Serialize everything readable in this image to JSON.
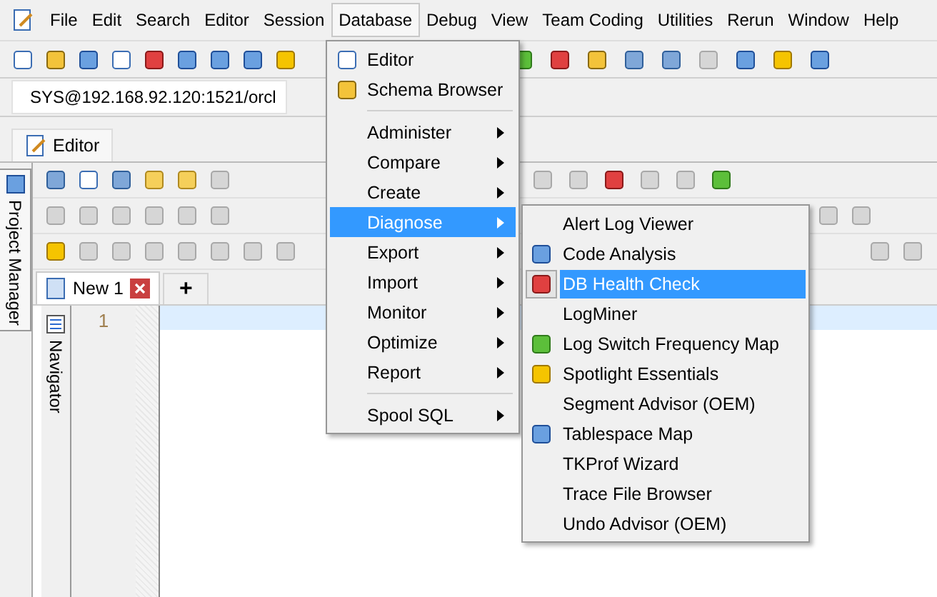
{
  "menu_bar": [
    {
      "label": "File",
      "selected": false
    },
    {
      "label": "Edit",
      "selected": false
    },
    {
      "label": "Search",
      "selected": false
    },
    {
      "label": "Editor",
      "selected": false
    },
    {
      "label": "Session",
      "selected": false
    },
    {
      "label": "Database",
      "selected": true
    },
    {
      "label": "Debug",
      "selected": false
    },
    {
      "label": "View",
      "selected": false
    },
    {
      "label": "Team Coding",
      "selected": false
    },
    {
      "label": "Utilities",
      "selected": false
    },
    {
      "label": "Rerun",
      "selected": false
    },
    {
      "label": "Window",
      "selected": false
    },
    {
      "label": "Help",
      "selected": false
    }
  ],
  "connection": {
    "label": "SYS@192.168.92.120:1521/orcl"
  },
  "editor_tab": {
    "label": "Editor"
  },
  "side_tabs": {
    "project_manager": "Project Manager",
    "navigator": "Navigator"
  },
  "document_tabs": [
    {
      "label": "New 1",
      "selected": true
    }
  ],
  "new_tab_button": "+",
  "editor": {
    "line_numbers": [
      "1"
    ]
  },
  "database_menu": {
    "items": [
      {
        "kind": "item",
        "label": "Editor",
        "submenu": false,
        "selected": false
      },
      {
        "kind": "item",
        "label": "Schema Browser",
        "submenu": false,
        "selected": false
      },
      {
        "kind": "separator"
      },
      {
        "kind": "item",
        "label": "Administer",
        "submenu": true,
        "selected": false
      },
      {
        "kind": "item",
        "label": "Compare",
        "submenu": true,
        "selected": false
      },
      {
        "kind": "item",
        "label": "Create",
        "submenu": true,
        "selected": false
      },
      {
        "kind": "item",
        "label": "Diagnose",
        "submenu": true,
        "selected": true
      },
      {
        "kind": "item",
        "label": "Export",
        "submenu": true,
        "selected": false
      },
      {
        "kind": "item",
        "label": "Import",
        "submenu": true,
        "selected": false
      },
      {
        "kind": "item",
        "label": "Monitor",
        "submenu": true,
        "selected": false
      },
      {
        "kind": "item",
        "label": "Optimize",
        "submenu": true,
        "selected": false
      },
      {
        "kind": "item",
        "label": "Report",
        "submenu": true,
        "selected": false
      },
      {
        "kind": "separator"
      },
      {
        "kind": "item",
        "label": "Spool SQL",
        "submenu": true,
        "selected": false
      }
    ]
  },
  "diagnose_submenu": {
    "items": [
      {
        "label": "Alert Log Viewer",
        "selected": false
      },
      {
        "label": "Code Analysis",
        "selected": false
      },
      {
        "label": "DB Health Check",
        "selected": true
      },
      {
        "label": "LogMiner",
        "selected": false
      },
      {
        "label": "Log Switch Frequency Map",
        "selected": false
      },
      {
        "label": "Spotlight Essentials",
        "selected": false
      },
      {
        "label": "Segment Advisor (OEM)",
        "selected": false
      },
      {
        "label": "Tablespace Map",
        "selected": false
      },
      {
        "label": "TKProf Wizard",
        "selected": false
      },
      {
        "label": "Trace File Browser",
        "selected": false
      },
      {
        "label": "Undo Advisor (OEM)",
        "selected": false
      }
    ]
  }
}
